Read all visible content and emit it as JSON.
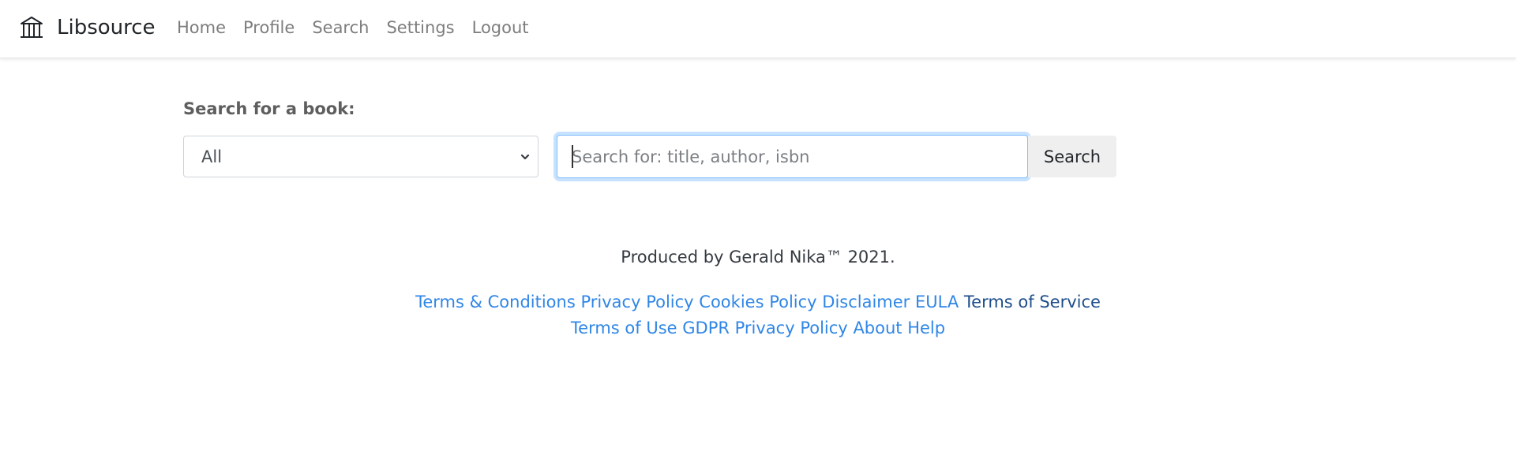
{
  "brand": {
    "name": "Libsource",
    "icon": "library-building-icon"
  },
  "nav": [
    {
      "label": "Home"
    },
    {
      "label": "Profile"
    },
    {
      "label": "Search"
    },
    {
      "label": "Settings"
    },
    {
      "label": "Logout"
    }
  ],
  "search": {
    "label": "Search for a book:",
    "category_selected": "All",
    "input_value": "",
    "placeholder": "Search for: title, author, isbn",
    "button_label": "Search"
  },
  "footer": {
    "credit": "Produced by Gerald Nika™ 2021.",
    "links": [
      {
        "label": "Terms & Conditions"
      },
      {
        "label": "Privacy Policy"
      },
      {
        "label": "Cookies Policy"
      },
      {
        "label": "Disclaimer"
      },
      {
        "label": "EULA"
      },
      {
        "label": "Terms of Service"
      },
      {
        "label": "Terms of Use"
      },
      {
        "label": "GDPR Privacy Policy"
      },
      {
        "label": "About"
      },
      {
        "label": "Help"
      }
    ]
  },
  "colors": {
    "link": "#2f86e6",
    "link_dark": "#1f4e8c",
    "nav_text": "#7d7d7d",
    "focus_ring": "#80bdff",
    "button_bg": "#efefef"
  }
}
